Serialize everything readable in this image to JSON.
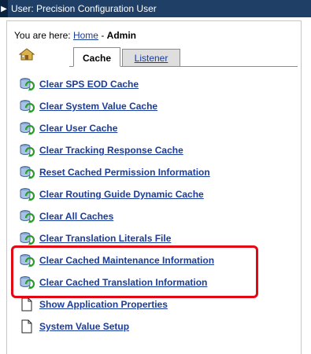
{
  "window": {
    "title": "User: Precision Configuration User"
  },
  "breadcrumb": {
    "prefix": "You are here:",
    "home": "Home",
    "separator": "-",
    "current": "Admin"
  },
  "tabs": [
    {
      "label": "Cache",
      "active": true
    },
    {
      "label": "Listener",
      "active": false
    }
  ],
  "links": [
    {
      "label": "Clear SPS EOD Cache",
      "icon": "cache-refresh-icon"
    },
    {
      "label": "Clear System Value Cache",
      "icon": "cache-refresh-icon"
    },
    {
      "label": "Clear User Cache",
      "icon": "cache-refresh-icon"
    },
    {
      "label": "Clear Tracking Response Cache",
      "icon": "cache-refresh-icon"
    },
    {
      "label": "Reset Cached Permission Information",
      "icon": "cache-refresh-icon"
    },
    {
      "label": "Clear Routing Guide Dynamic Cache",
      "icon": "cache-refresh-icon"
    },
    {
      "label": "Clear All Caches",
      "icon": "cache-refresh-icon"
    },
    {
      "label": "Clear Translation Literals File",
      "icon": "cache-refresh-icon"
    },
    {
      "label": "Clear Cached Maintenance Information",
      "icon": "cache-refresh-icon"
    },
    {
      "label": "Clear Cached Translation Information",
      "icon": "cache-refresh-icon"
    },
    {
      "label": "Show Application Properties",
      "icon": "document-icon"
    },
    {
      "label": "System Value Setup",
      "icon": "document-icon"
    }
  ],
  "colors": {
    "titlebar": "#1f3f66",
    "link": "#1a3c9b",
    "highlight": "#e30613"
  }
}
